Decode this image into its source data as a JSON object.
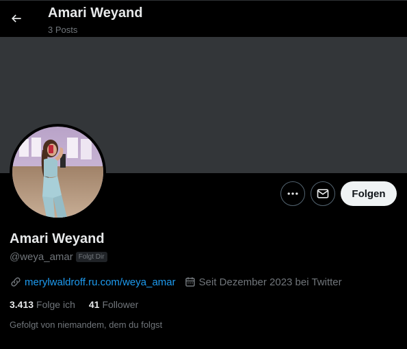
{
  "header": {
    "back_icon": "arrow-left-icon",
    "title": "Amari Weyand",
    "posts_count": "3 Posts"
  },
  "profile": {
    "display_name": "Amari Weyand",
    "handle": "@weya_amar",
    "follows_you_badge": "Folgt Dir",
    "website": "merylwaldroff.ru.com/weya_amar",
    "joined": "Seit Dezember 2023 bei Twitter",
    "following_count": "3.413",
    "following_label": "Folge ich",
    "followers_count": "41",
    "followers_label": "Follower",
    "mutuals_note": "Gefolgt von niemandem, dem du folgst"
  },
  "actions": {
    "more_icon": "more-horizontal-icon",
    "message_icon": "envelope-icon",
    "follow_label": "Folgen"
  },
  "colors": {
    "background": "#000000",
    "banner": "#333639",
    "primary_text": "#e7e9ea",
    "secondary_text": "#71767b",
    "link": "#1d9bf0",
    "follow_button_bg": "#eff3f4"
  }
}
